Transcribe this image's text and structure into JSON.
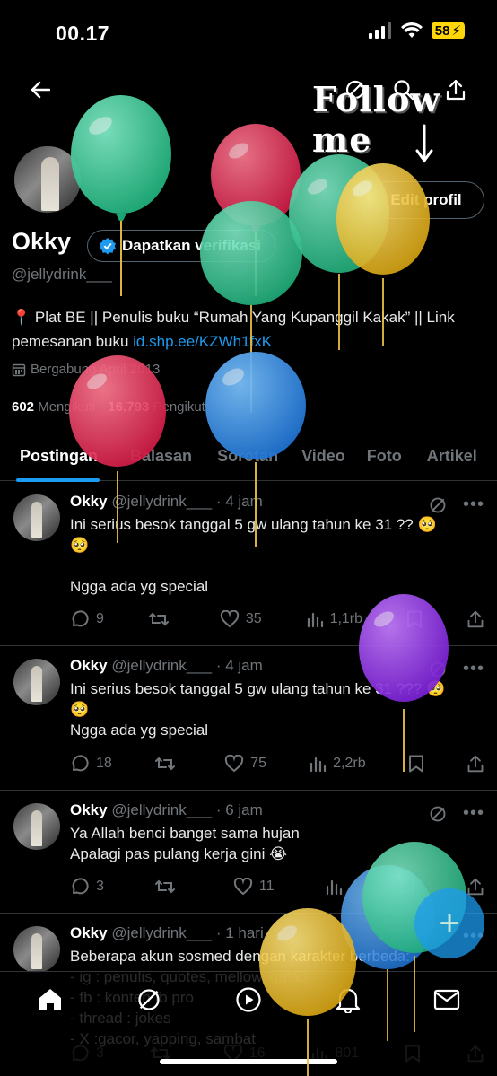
{
  "status_bar": {
    "time": "00.17",
    "battery": "58"
  },
  "overlay": {
    "follow_text": "Follow me"
  },
  "profile": {
    "name": "Okky",
    "verify_label": "Dapatkan verifikasi",
    "handle": "@jellydrink___",
    "edit_label": "Edit profil",
    "bio_text": "📍 Plat BE || Penulis buku “Rumah Yang Kupanggil Kakak” || Link pemesanan buku ",
    "bio_link": "id.shp.ee/KZWh1fxK",
    "joined": "Bergabung April 2013",
    "following_count": "602",
    "following_label": "Mengikuti",
    "followers_count": "16.793",
    "followers_label": "Pengikut"
  },
  "tabs": [
    {
      "label": "Postingan",
      "active": true
    },
    {
      "label": "Balasan"
    },
    {
      "label": "Sorotan"
    },
    {
      "label": "Video"
    },
    {
      "label": "Foto"
    },
    {
      "label": "Artikel"
    }
  ],
  "posts": [
    {
      "name": "Okky",
      "handle": "@jellydrink___",
      "time": "· 4 jam",
      "text": "Ini serius besok tanggal 5 gw ulang tahun ke 31 ?? 🥺\n🥺\n\nNgga ada yg special",
      "replies": "9",
      "reposts": "",
      "likes": "35",
      "views": "1,1rb"
    },
    {
      "name": "Okky",
      "handle": "@jellydrink___",
      "time": "· 4 jam",
      "text": "Ini serius besok tanggal 5 gw ulang tahun ke 31 ??? 🥺\n🥺\nNgga ada yg special",
      "replies": "18",
      "reposts": "",
      "likes": "75",
      "views": "2,2rb"
    },
    {
      "name": "Okky",
      "handle": "@jellydrink___",
      "time": "· 6 jam",
      "text": "Ya Allah benci banget sama hujan\nApalagi pas pulang kerja gini 😭",
      "replies": "3",
      "reposts": "",
      "likes": "11",
      "views": ""
    },
    {
      "name": "Okky",
      "handle": "@jellydrink___",
      "time": "· 1 hari",
      "text": "Beberapa akun sosmed dengan karakter berbeda:\n- ig : penulis, quotes, mellow, galau\n- fb : konten fb pro\n- thread : jokes\n- X :gacor, yapping, sambat",
      "replies": "3",
      "reposts": "",
      "likes": "16",
      "views": "801"
    }
  ],
  "fab_label": "+",
  "colors": {
    "accent": "#1d9bf0",
    "background": "#000000",
    "muted": "#71767b",
    "battery": "#ffd60a"
  },
  "icons": [
    "back-arrow-icon",
    "grok-icon",
    "search-icon",
    "share-icon",
    "calendar-icon",
    "verified-badge-icon",
    "reply-icon",
    "repost-icon",
    "like-icon",
    "views-icon",
    "bookmark-icon",
    "home-icon",
    "search-nav-icon",
    "play-icon",
    "bell-icon",
    "mail-icon"
  ]
}
